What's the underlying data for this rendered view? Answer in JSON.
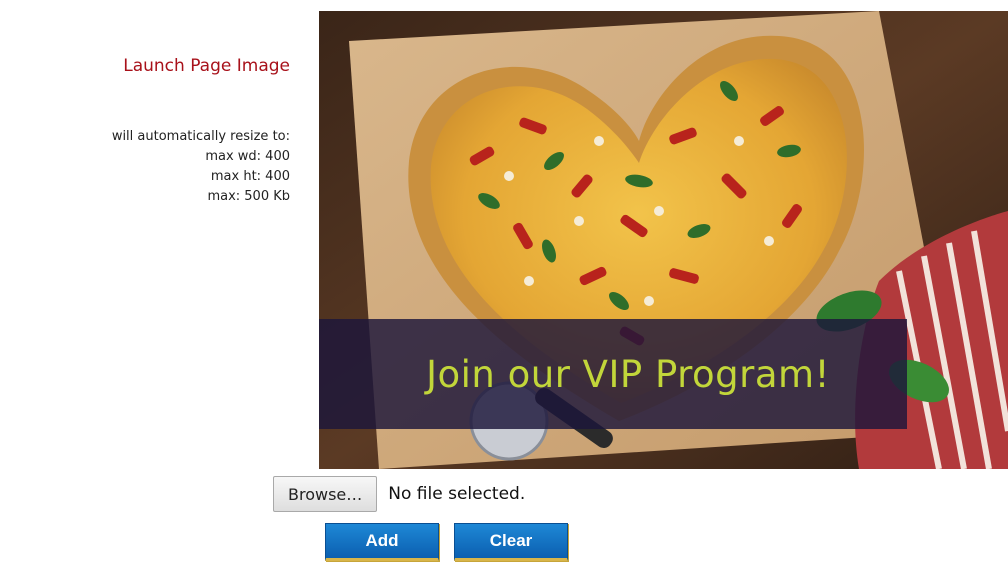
{
  "section": {
    "title": "Launch Page Image",
    "hints": [
      "will automatically resize to:",
      "max wd: 400",
      "max ht: 400",
      "max: 500 Kb"
    ]
  },
  "preview": {
    "banner_text": "Join our VIP Program!",
    "banner_text_color": "#c2d63a"
  },
  "file_input": {
    "browse_label": "Browse…",
    "status_text": "No file selected."
  },
  "actions": {
    "add_label": "Add",
    "clear_label": "Clear",
    "button_color": "#1473c4"
  }
}
